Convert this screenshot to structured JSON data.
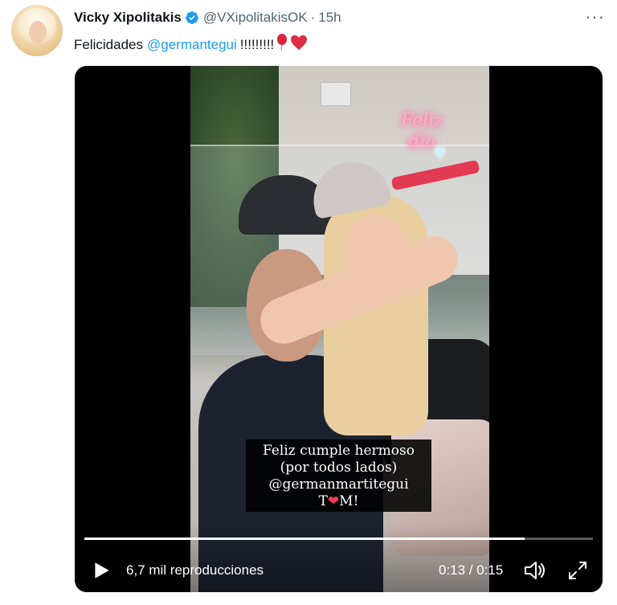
{
  "tweet": {
    "display_name": "Vicky Xipolitakis",
    "handle": "@VXipolitakisOK",
    "separator": "·",
    "time": "15h",
    "more_label": "···",
    "text_prefix": "Felicidades",
    "mention": "@germantegui",
    "text_suffix": "!!!!!!!!!",
    "emoji_1": "🎈",
    "emoji_2": "❤️",
    "verified_color": "#1d9bf0",
    "mention_color": "#1d9bf0"
  },
  "media": {
    "story_caption": {
      "line_1": "Feliz cumple hermoso",
      "line_2": "(por todos lados)",
      "line_3": "@germanmartitegui",
      "line_4_pre": "T",
      "line_4_heart": "❤",
      "line_4_post": "M!"
    },
    "neon_sign": {
      "line_1": "Feliz",
      "line_2": "día"
    },
    "player": {
      "views": "6,7 mil reproducciones",
      "time_readout": "0:13 / 0:15",
      "progress_fraction": 0.866,
      "play_icon": "play-icon",
      "volume_icon": "volume-icon",
      "fullscreen_icon": "fullscreen-icon"
    }
  }
}
